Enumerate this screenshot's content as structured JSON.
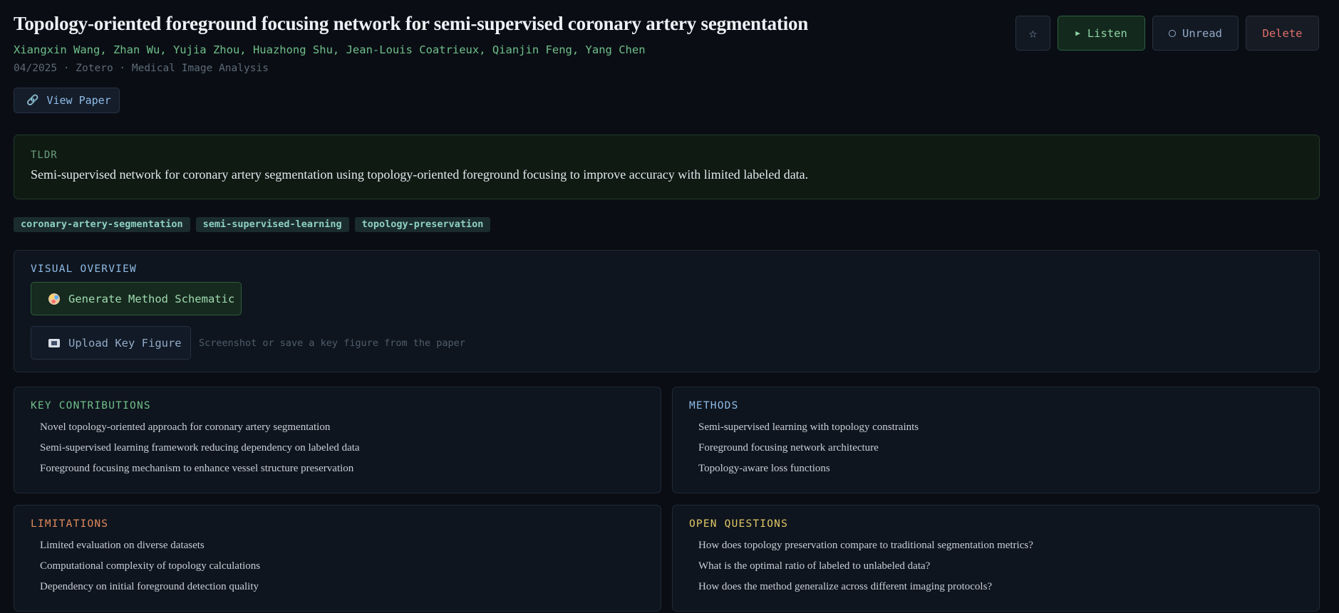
{
  "paper": {
    "title": "Topology-oriented foreground focusing network for semi-supervised coronary artery segmentation",
    "authors": "Xiangxin Wang, Zhan Wu, Yujia Zhou, Huazhong Shu, Jean-Louis Coatrieux, Qianjin Feng, Yang Chen",
    "meta": "04/2025 · Zotero · Medical Image Analysis",
    "view_paper_label": "View Paper",
    "view_paper_icon": "link-icon"
  },
  "actions": {
    "star_icon": "star-icon",
    "listen_label": "Listen",
    "unread_label": "Unread",
    "delete_label": "Delete"
  },
  "tldr": {
    "label": "TLDR",
    "text": "Semi-supervised network for coronary artery segmentation using topology-oriented foreground focusing to improve accuracy with limited labeled data."
  },
  "tags": [
    "coronary-artery-segmentation",
    "semi-supervised-learning",
    "topology-preservation"
  ],
  "visual_overview": {
    "title": "VISUAL OVERVIEW",
    "generate_label": "Generate Method Schematic",
    "upload_label": "Upload Key Figure",
    "upload_hint": "Screenshot or save a key figure from the paper"
  },
  "sections": {
    "contributions": {
      "title": "KEY CONTRIBUTIONS",
      "items": [
        "Novel topology-oriented approach for coronary artery segmentation",
        "Semi-supervised learning framework reducing dependency on labeled data",
        "Foreground focusing mechanism to enhance vessel structure preservation"
      ]
    },
    "methods": {
      "title": "METHODS",
      "items": [
        "Semi-supervised learning with topology constraints",
        "Foreground focusing network architecture",
        "Topology-aware loss functions"
      ]
    },
    "limitations": {
      "title": "LIMITATIONS",
      "items": [
        "Limited evaluation on diverse datasets",
        "Computational complexity of topology calculations",
        "Dependency on initial foreground detection quality"
      ]
    },
    "open_questions": {
      "title": "OPEN QUESTIONS",
      "items": [
        "How does topology preservation compare to traditional segmentation metrics?",
        "What is the optimal ratio of labeled to unlabeled data?",
        "How does the method generalize across different imaging protocols?"
      ]
    }
  },
  "colors": {
    "background": "#0a0e14",
    "accent_green": "#6fbf8a",
    "accent_blue": "#8fbce8",
    "danger": "#e0706a",
    "warning": "#e0c766",
    "orange": "#e08a5c"
  }
}
